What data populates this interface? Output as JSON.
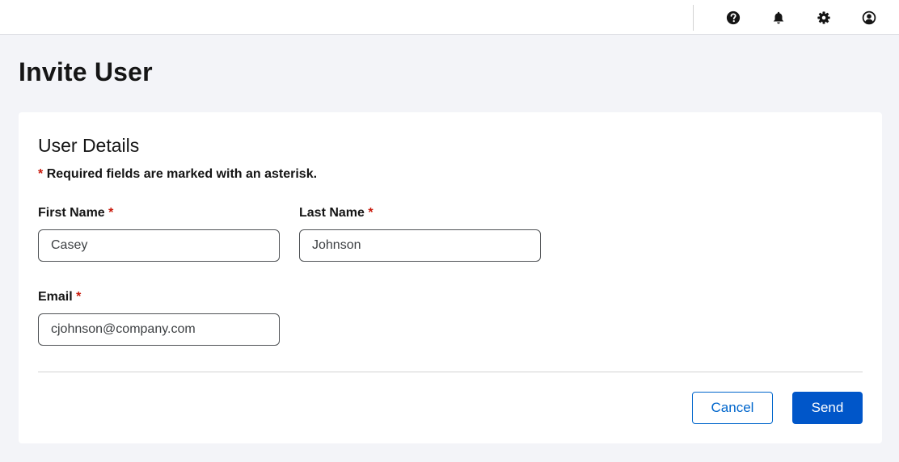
{
  "topbar": {
    "icons": [
      {
        "name": "help-icon"
      },
      {
        "name": "bell-icon"
      },
      {
        "name": "gear-icon"
      },
      {
        "name": "user-icon"
      }
    ]
  },
  "page": {
    "title": "Invite User"
  },
  "card": {
    "section_title": "User Details",
    "required_note": {
      "asterisk": "*",
      "text": "Required fields are marked with an asterisk."
    },
    "fields": {
      "first_name": {
        "label": "First Name",
        "asterisk": "*",
        "value": "Casey"
      },
      "last_name": {
        "label": "Last Name",
        "asterisk": "*",
        "value": "Johnson"
      },
      "email": {
        "label": "Email",
        "asterisk": "*",
        "value": "cjohnson@company.com"
      }
    },
    "actions": {
      "cancel_label": "Cancel",
      "send_label": "Send"
    }
  },
  "colors": {
    "accent": "#0066cc",
    "primary_button": "#0056c9",
    "required": "#c9190b",
    "background": "#f3f4f8"
  }
}
